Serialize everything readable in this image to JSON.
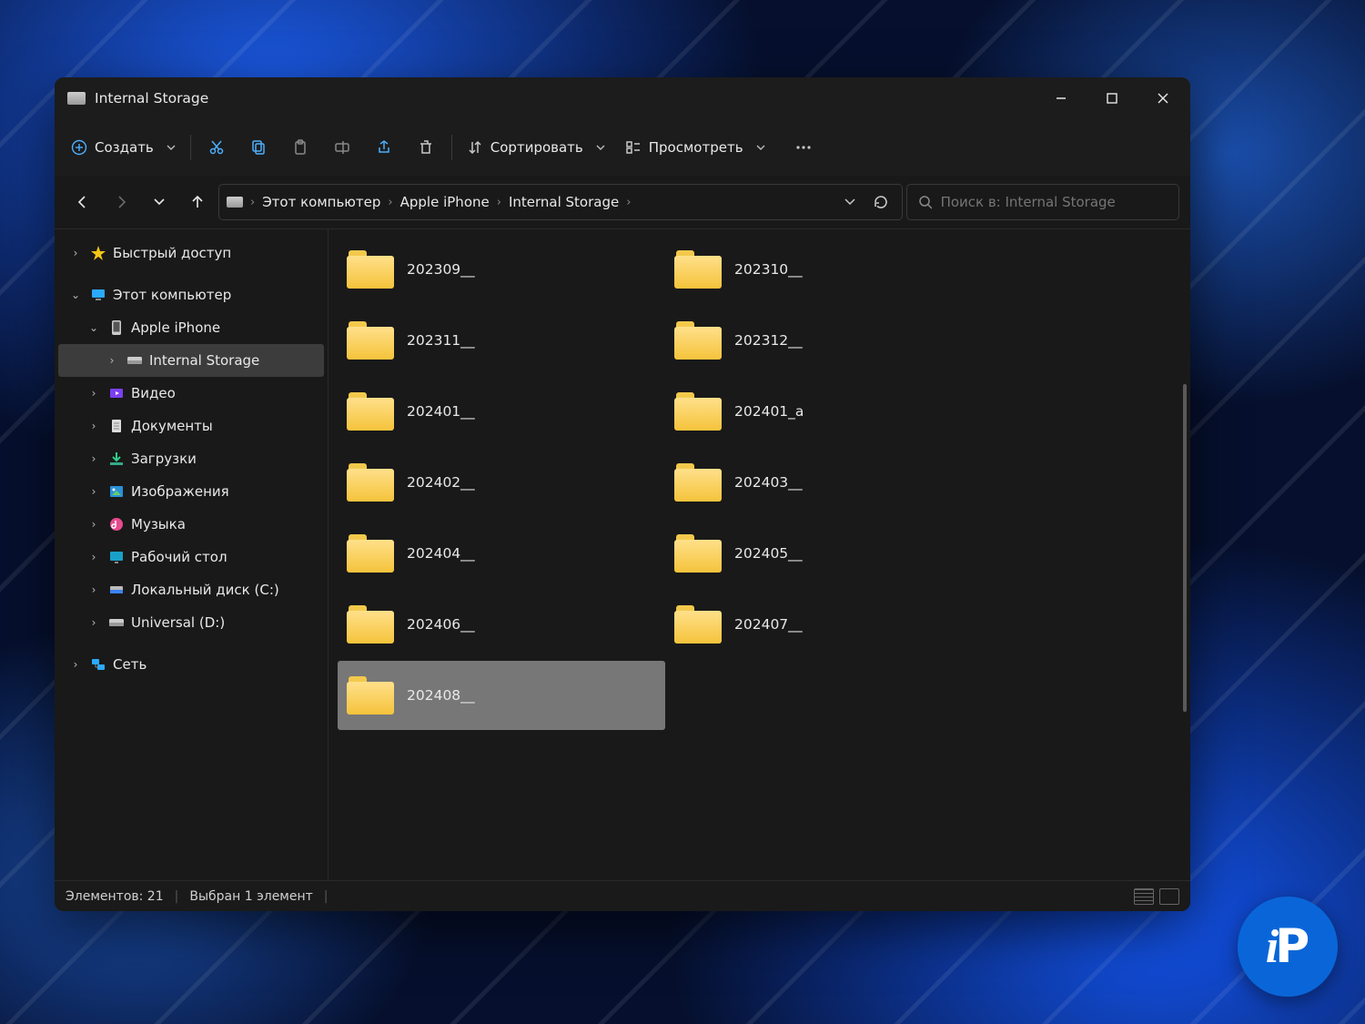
{
  "window": {
    "title": "Internal Storage"
  },
  "toolbar": {
    "create_label": "Создать",
    "sort_label": "Сортировать",
    "view_label": "Просмотреть"
  },
  "breadcrumb": {
    "items": [
      "Этот компьютер",
      "Apple iPhone",
      "Internal Storage"
    ]
  },
  "search": {
    "placeholder": "Поиск в: Internal Storage"
  },
  "sidebar": {
    "items": [
      {
        "label": "Быстрый доступ",
        "icon": "star",
        "indent": 0,
        "exp": "›"
      },
      {
        "label": "Этот компьютер",
        "icon": "pc",
        "indent": 0,
        "exp": "⌄"
      },
      {
        "label": "Apple iPhone",
        "icon": "phone",
        "indent": 1,
        "exp": "⌄"
      },
      {
        "label": "Internal Storage",
        "icon": "drive",
        "indent": 2,
        "exp": "›",
        "selected": true
      },
      {
        "label": "Видео",
        "icon": "video",
        "indent": 1,
        "exp": "›"
      },
      {
        "label": "Документы",
        "icon": "doc",
        "indent": 1,
        "exp": "›"
      },
      {
        "label": "Загрузки",
        "icon": "download",
        "indent": 1,
        "exp": "›"
      },
      {
        "label": "Изображения",
        "icon": "image",
        "indent": 1,
        "exp": "›"
      },
      {
        "label": "Музыка",
        "icon": "music",
        "indent": 1,
        "exp": "›"
      },
      {
        "label": "Рабочий стол",
        "icon": "desktop",
        "indent": 1,
        "exp": "›"
      },
      {
        "label": "Локальный диск (C:)",
        "icon": "disk",
        "indent": 1,
        "exp": "›"
      },
      {
        "label": "Universal (D:)",
        "icon": "drive",
        "indent": 1,
        "exp": "›"
      },
      {
        "label": "Сеть",
        "icon": "network",
        "indent": 0,
        "exp": "›"
      }
    ]
  },
  "folders": [
    {
      "name": "202309__"
    },
    {
      "name": "202310__"
    },
    {
      "name": "202311__"
    },
    {
      "name": "202312__"
    },
    {
      "name": "202401__"
    },
    {
      "name": "202401_a"
    },
    {
      "name": "202402__"
    },
    {
      "name": "202403__"
    },
    {
      "name": "202404__"
    },
    {
      "name": "202405__"
    },
    {
      "name": "202406__"
    },
    {
      "name": "202407__"
    },
    {
      "name": "202408__",
      "selected": true
    }
  ],
  "status": {
    "count_label": "Элементов: 21",
    "selection_label": "Выбран 1 элемент"
  },
  "badge": {
    "text": "iP"
  }
}
